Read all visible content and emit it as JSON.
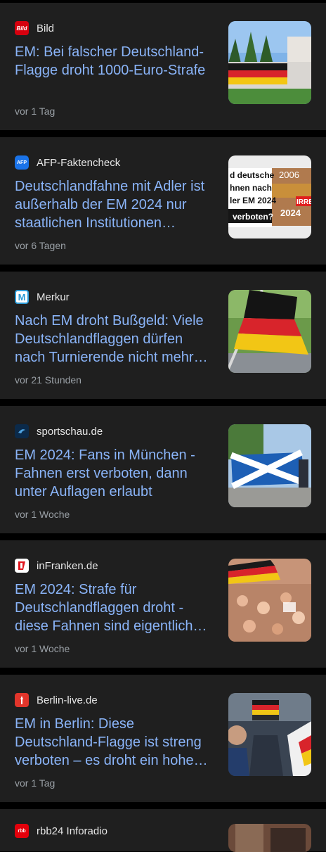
{
  "articles": [
    {
      "source": "Bild",
      "logo_text": "Bild",
      "logo_color": "#d6000e",
      "headline": "EM: Bei falscher Deutschland-Flagge droht 1000-Euro-Strafe",
      "time": "vor 1 Tag",
      "thumb": "flag-on-fence-photo"
    },
    {
      "source": "AFP-Faktencheck",
      "logo_text": "AFP",
      "logo_color": "#1a73e8",
      "headline": "Deutschlandfahne mit Adler ist außerhalb der EM 2024 nur staatlichen Institutionen…",
      "time": "vor 6 Tagen",
      "thumb": "factcheck-collage",
      "thumb_text": [
        "d deutsche",
        "hnen nach",
        "ler EM 2024",
        "verboten?",
        "2006",
        "2024",
        "IRRE"
      ]
    },
    {
      "source": "Merkur",
      "logo_text": "M",
      "logo_color": "#2c9ad6",
      "headline": "Nach EM droht Bußgeld: Viele Deutschlandflaggen dürfen nach Turnierende nicht mehr…",
      "time": "vor 21 Stunden",
      "thumb": "german-flag-photo"
    },
    {
      "source": "sportschau.de",
      "logo_text": "",
      "logo_color": "#0b2a4a",
      "headline": "EM 2024: Fans in München - Fahnen erst verboten, dann unter Auflagen erlaubt",
      "time": "vor 1 Woche",
      "thumb": "scotland-flag-photo"
    },
    {
      "source": "inFranken.de",
      "logo_text": "",
      "logo_color": "#e0161e",
      "headline": "EM 2024: Strafe für Deutschlandflaggen droht - diese Fahnen sind eigentlich…",
      "time": "vor 1 Woche",
      "thumb": "crowd-photo"
    },
    {
      "source": "Berlin-live.de",
      "logo_text": "",
      "logo_color": "#e2352b",
      "headline": "EM in Berlin: Diese Deutschland-Flagge ist streng verboten – es droht ein hohe…",
      "time": "vor 1 Tag",
      "thumb": "fans-photo"
    },
    {
      "source": "rbb24 Inforadio",
      "logo_text": "rbb",
      "logo_color": "#e3000b",
      "headline": "",
      "time": "",
      "thumb": "partial-photo"
    }
  ]
}
